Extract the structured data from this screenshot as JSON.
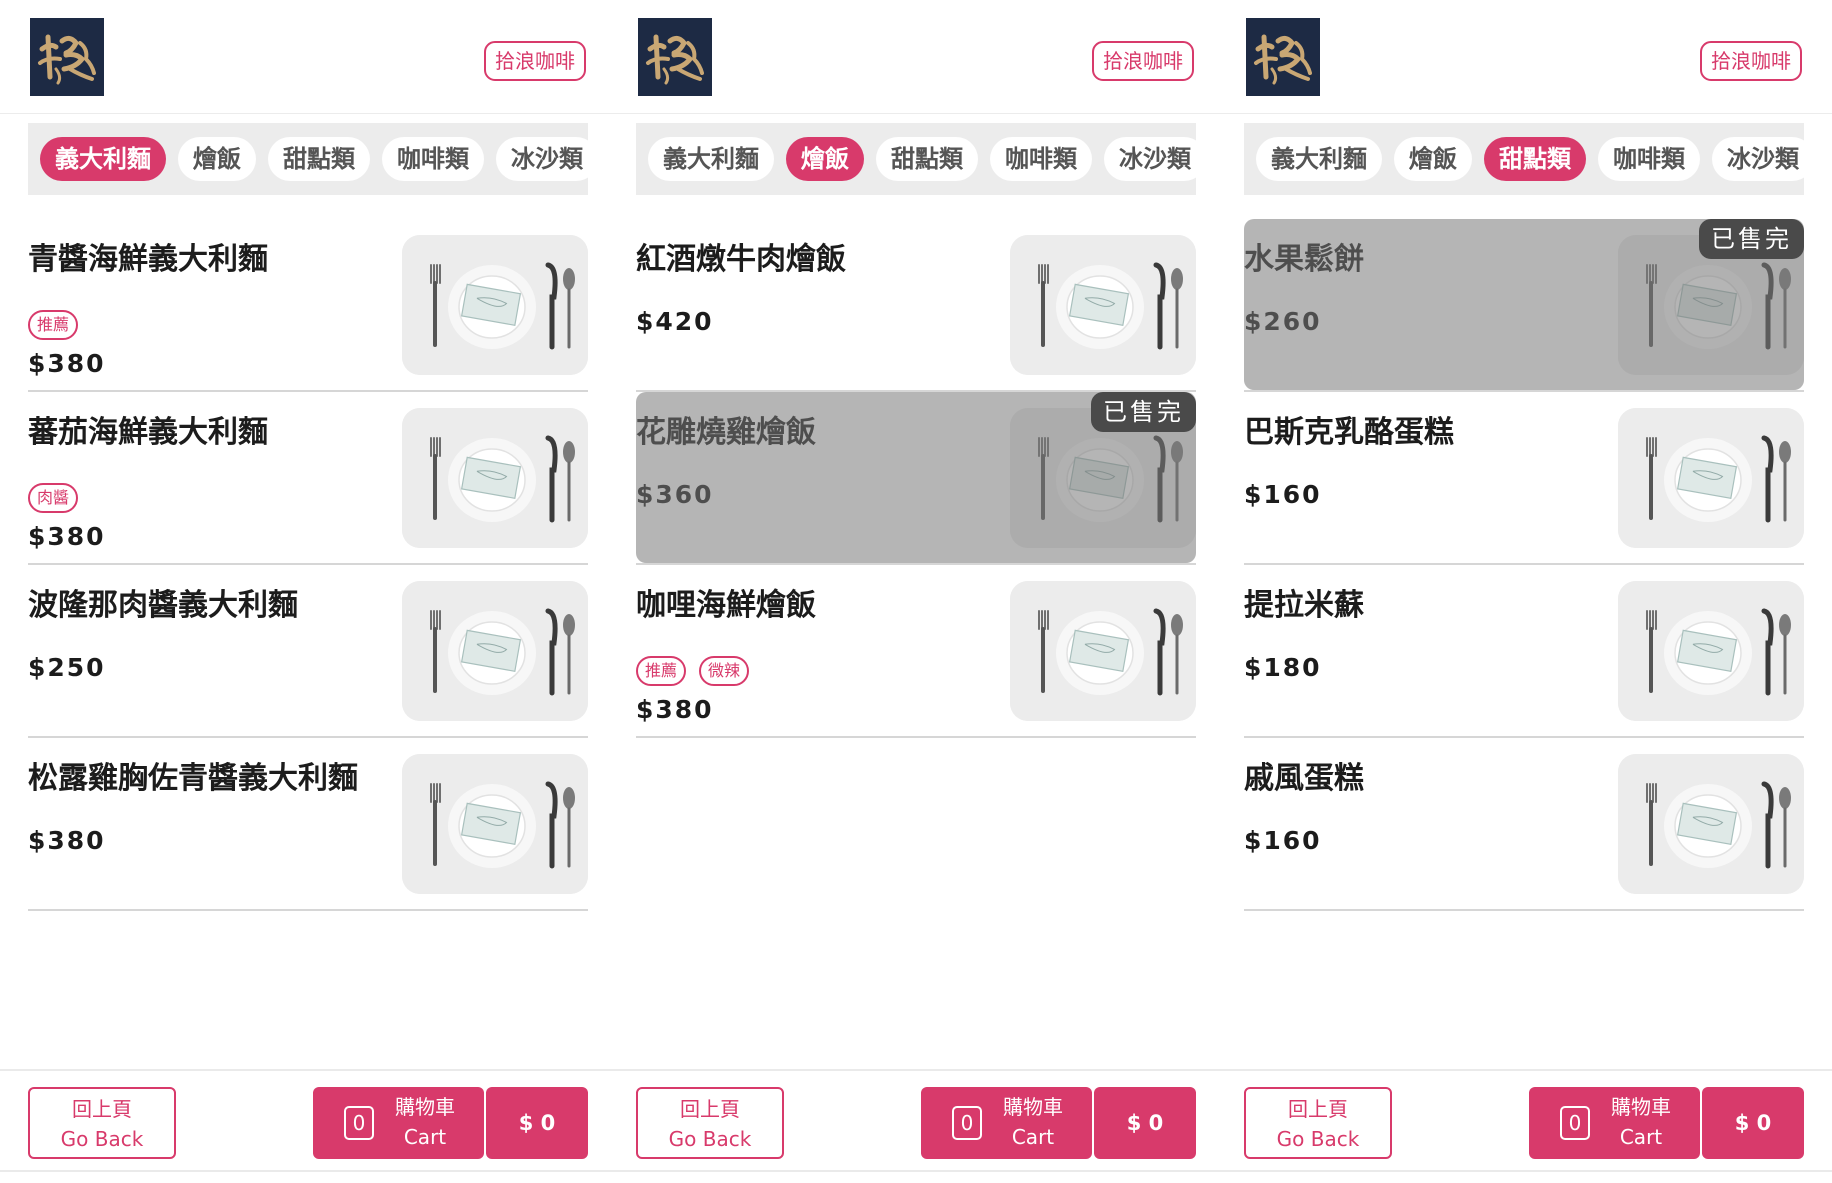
{
  "colors": {
    "accent": "#d83a6b",
    "logo_bg": "#1d2a44",
    "logo_ink": "#c9a774",
    "tabbar_bg": "#ececec",
    "soldout_overlay": "#787878"
  },
  "logo": {
    "icon": "brand-logo-calligraphy"
  },
  "shop_name": "拾浪咖啡",
  "tabs": [
    "義大利麵",
    "燴飯",
    "甜點類",
    "咖啡類",
    "冰沙類"
  ],
  "footer": {
    "back_zh": "回上頁",
    "back_en": "Go Back",
    "cart_zh": "購物車",
    "cart_en": "Cart",
    "cart_count": "0",
    "total": "$ 0"
  },
  "panels": [
    {
      "active_tab": 0,
      "items": [
        {
          "name": "青醬海鮮義大利麵",
          "price": "$380",
          "tags": [
            "推薦"
          ],
          "soldout": false
        },
        {
          "name": "蕃茄海鮮義大利麵",
          "price": "$380",
          "tags": [
            "肉醬"
          ],
          "soldout": false
        },
        {
          "name": "波隆那肉醬義大利麵",
          "price": "$250",
          "tags": [],
          "soldout": false
        },
        {
          "name": "松露雞胸佐青醬義大利麵",
          "price": "$380",
          "tags": [],
          "soldout": false
        }
      ]
    },
    {
      "active_tab": 1,
      "items": [
        {
          "name": "紅酒燉牛肉燴飯",
          "price": "$420",
          "tags": [],
          "soldout": false
        },
        {
          "name": "花雕燒雞燴飯",
          "price": "$360",
          "tags": [],
          "soldout": true,
          "soldout_label": "已售完"
        },
        {
          "name": "咖哩海鮮燴飯",
          "price": "$380",
          "tags": [
            "推薦",
            "微辣"
          ],
          "soldout": false
        }
      ]
    },
    {
      "active_tab": 2,
      "items": [
        {
          "name": "水果鬆餅",
          "price": "$260",
          "tags": [],
          "soldout": true,
          "soldout_label": "已售完"
        },
        {
          "name": "巴斯克乳酪蛋糕",
          "price": "$160",
          "tags": [],
          "soldout": false
        },
        {
          "name": "提拉米蘇",
          "price": "$180",
          "tags": [],
          "soldout": false
        },
        {
          "name": "戚風蛋糕",
          "price": "$160",
          "tags": [],
          "soldout": false
        }
      ]
    }
  ]
}
